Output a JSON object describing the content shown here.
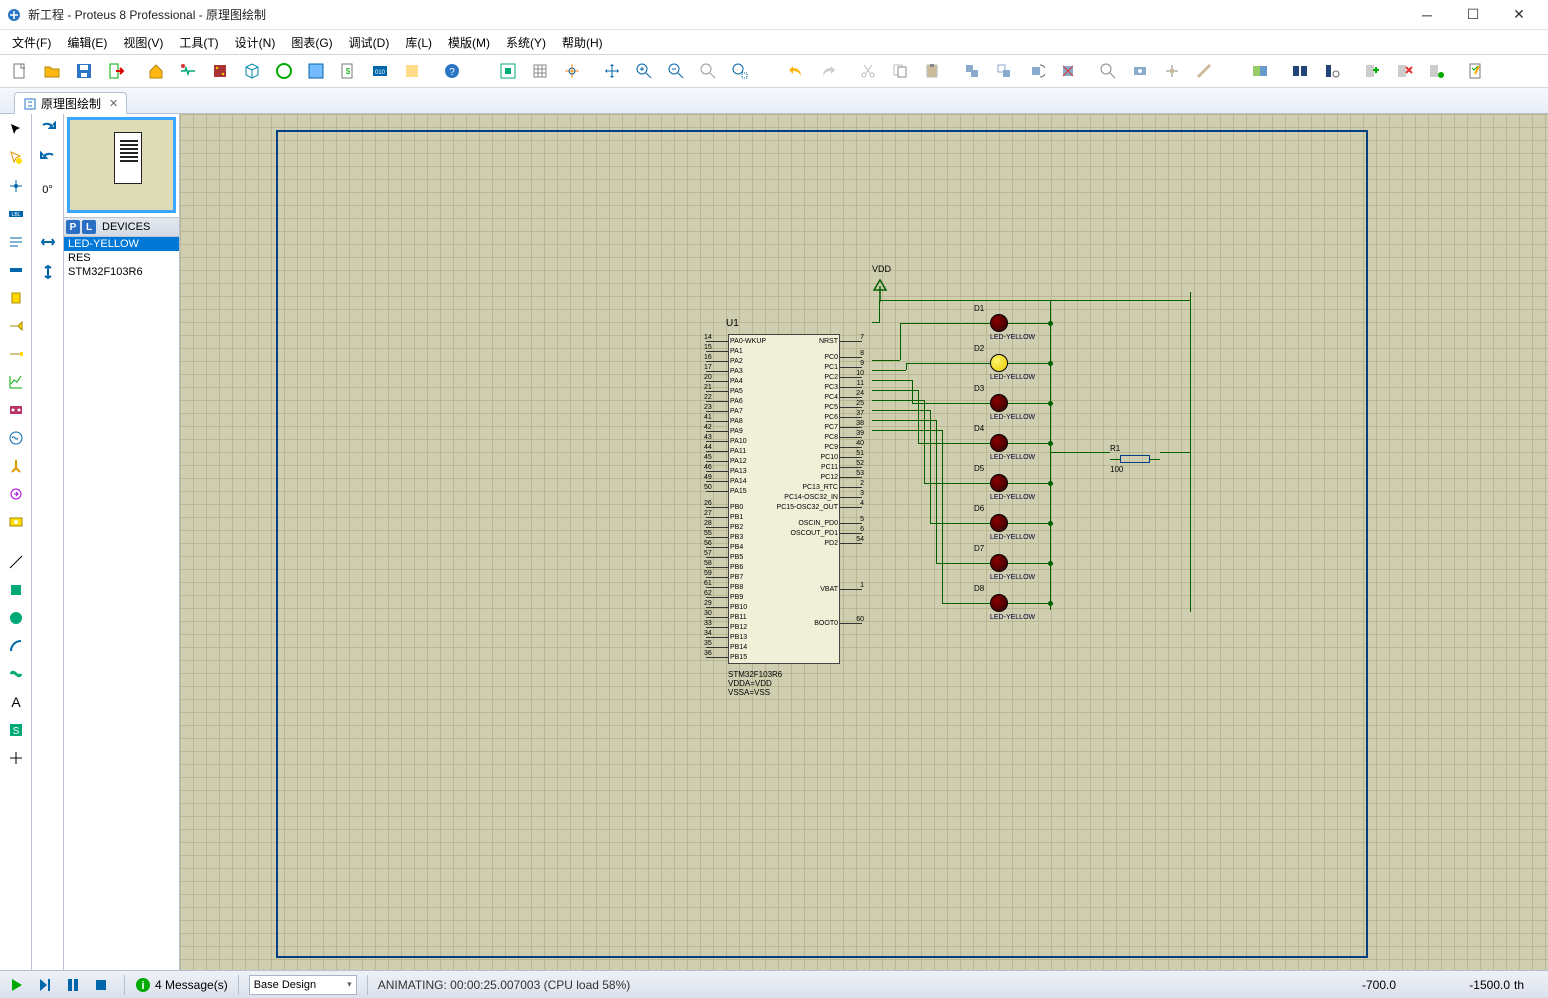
{
  "title": "新工程 - Proteus 8 Professional - 原理图绘制",
  "menu": {
    "file": "文件(F)",
    "edit": "编辑(E)",
    "view": "视图(V)",
    "tool": "工具(T)",
    "design": "设计(N)",
    "chart": "图表(G)",
    "debug": "调试(D)",
    "lib": "库(L)",
    "tpl": "模版(M)",
    "sys": "系统(Y)",
    "help": "帮助(H)"
  },
  "tab": {
    "label": "原理图绘制"
  },
  "sidepanel": {
    "head_p": "P",
    "head_l": "L",
    "head_dev": "DEVICES",
    "items": [
      "LED-YELLOW",
      "RES",
      "STM32F103R6"
    ],
    "selected": 0,
    "rotate_label": "0°"
  },
  "schematic": {
    "chip_ref": "U1",
    "chip_bottom": [
      "STM32F103R6",
      "VDDA=VDD",
      "VSSA=VSS"
    ],
    "left_pins": [
      {
        "n": "14",
        "t": "PA0-WKUP"
      },
      {
        "n": "15",
        "t": "PA1"
      },
      {
        "n": "16",
        "t": "PA2"
      },
      {
        "n": "17",
        "t": "PA3"
      },
      {
        "n": "20",
        "t": "PA4"
      },
      {
        "n": "21",
        "t": "PA5"
      },
      {
        "n": "22",
        "t": "PA6"
      },
      {
        "n": "23",
        "t": "PA7"
      },
      {
        "n": "41",
        "t": "PA8"
      },
      {
        "n": "42",
        "t": "PA9"
      },
      {
        "n": "43",
        "t": "PA10"
      },
      {
        "n": "44",
        "t": "PA11"
      },
      {
        "n": "45",
        "t": "PA12"
      },
      {
        "n": "46",
        "t": "PA13"
      },
      {
        "n": "49",
        "t": "PA14"
      },
      {
        "n": "50",
        "t": "PA15"
      },
      null,
      {
        "n": "26",
        "t": "PB0"
      },
      {
        "n": "27",
        "t": "PB1"
      },
      {
        "n": "28",
        "t": "PB2"
      },
      {
        "n": "55",
        "t": "PB3"
      },
      {
        "n": "56",
        "t": "PB4"
      },
      {
        "n": "57",
        "t": "PB5"
      },
      {
        "n": "58",
        "t": "PB6"
      },
      {
        "n": "59",
        "t": "PB7"
      },
      {
        "n": "61",
        "t": "PB8"
      },
      {
        "n": "62",
        "t": "PB9"
      },
      {
        "n": "29",
        "t": "PB10"
      },
      {
        "n": "30",
        "t": "PB11"
      },
      {
        "n": "33",
        "t": "PB12"
      },
      {
        "n": "34",
        "t": "PB13"
      },
      {
        "n": "35",
        "t": "PB14"
      },
      {
        "n": "36",
        "t": "PB15"
      }
    ],
    "right_pins": [
      {
        "n": "7",
        "t": "NRST"
      },
      null,
      {
        "n": "8",
        "t": "PC0"
      },
      {
        "n": "9",
        "t": "PC1"
      },
      {
        "n": "10",
        "t": "PC2"
      },
      {
        "n": "11",
        "t": "PC3"
      },
      {
        "n": "24",
        "t": "PC4"
      },
      {
        "n": "25",
        "t": "PC5"
      },
      {
        "n": "37",
        "t": "PC6"
      },
      {
        "n": "38",
        "t": "PC7"
      },
      {
        "n": "39",
        "t": "PC8"
      },
      {
        "n": "40",
        "t": "PC9"
      },
      {
        "n": "51",
        "t": "PC10"
      },
      {
        "n": "52",
        "t": "PC11"
      },
      {
        "n": "53",
        "t": "PC12"
      },
      {
        "n": "2",
        "t": "PC13_RTC"
      },
      {
        "n": "3",
        "t": "PC14-OSC32_IN"
      },
      {
        "n": "4",
        "t": "PC15-OSC32_OUT"
      },
      null,
      {
        "n": "5",
        "t": "OSCIN_PD0"
      },
      {
        "n": "6",
        "t": "OSCOUT_PD1"
      },
      {
        "n": "54",
        "t": "PD2"
      },
      null,
      null,
      null,
      null,
      null,
      null,
      {
        "n": "1",
        "t": "VBAT"
      },
      null,
      null,
      null,
      null,
      {
        "n": "60",
        "t": "BOOT0"
      }
    ],
    "leds": [
      {
        "ref": "D1",
        "type": "LED-YELLOW",
        "on": false
      },
      {
        "ref": "D2",
        "type": "LED-YELLOW",
        "on": true
      },
      {
        "ref": "D3",
        "type": "LED-YELLOW",
        "on": false
      },
      {
        "ref": "D4",
        "type": "LED-YELLOW",
        "on": false
      },
      {
        "ref": "D5",
        "type": "LED-YELLOW",
        "on": false
      },
      {
        "ref": "D6",
        "type": "LED-YELLOW",
        "on": false
      },
      {
        "ref": "D7",
        "type": "LED-YELLOW",
        "on": false
      },
      {
        "ref": "D8",
        "type": "LED-YELLOW",
        "on": false
      }
    ],
    "vdd": "VDD",
    "res_ref": "R1",
    "res_val": "100"
  },
  "status": {
    "messages": "4 Message(s)",
    "design_sel": "Base Design",
    "anim": "ANIMATING: 00:00:25.007003 (CPU load 58%)",
    "coord_x": "-700.0",
    "coord_y": "-1500.0",
    "coord_unit": "th"
  }
}
